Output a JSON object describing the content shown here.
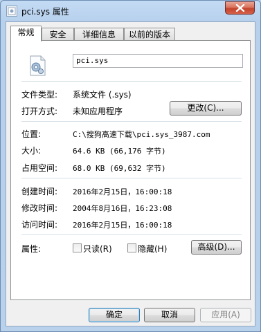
{
  "window": {
    "title": "pci.sys 属性"
  },
  "tabs": [
    {
      "label": "常规"
    },
    {
      "label": "安全"
    },
    {
      "label": "详细信息"
    },
    {
      "label": "以前的版本"
    }
  ],
  "general": {
    "file_name": "pci.sys",
    "file_type_label": "文件类型:",
    "file_type_value": "系统文件 (.sys)",
    "opens_with_label": "打开方式:",
    "opens_with_value": "未知应用程序",
    "change_button": "更改(C)...",
    "location_label": "位置:",
    "location_value": "C:\\搜狗高速下载\\pci.sys_3987.com",
    "size_label": "大小:",
    "size_value": "64.6 KB (66,176 字节)",
    "size_on_disk_label": "占用空间:",
    "size_on_disk_value": "68.0 KB (69,632 字节)",
    "created_label": "创建时间:",
    "created_value": "2016年2月15日，16:00:18",
    "modified_label": "修改时间:",
    "modified_value": "2004年8月16日，16:23:08",
    "accessed_label": "访问时间:",
    "accessed_value": "2016年2月15日，16:00:18",
    "attributes_label": "属性:",
    "readonly_label": "只读(R)",
    "readonly_checked": false,
    "hidden_label": "隐藏(H)",
    "hidden_checked": false,
    "advanced_button": "高级(D)..."
  },
  "footer": {
    "ok": "确定",
    "cancel": "取消",
    "apply": "应用(A)"
  }
}
